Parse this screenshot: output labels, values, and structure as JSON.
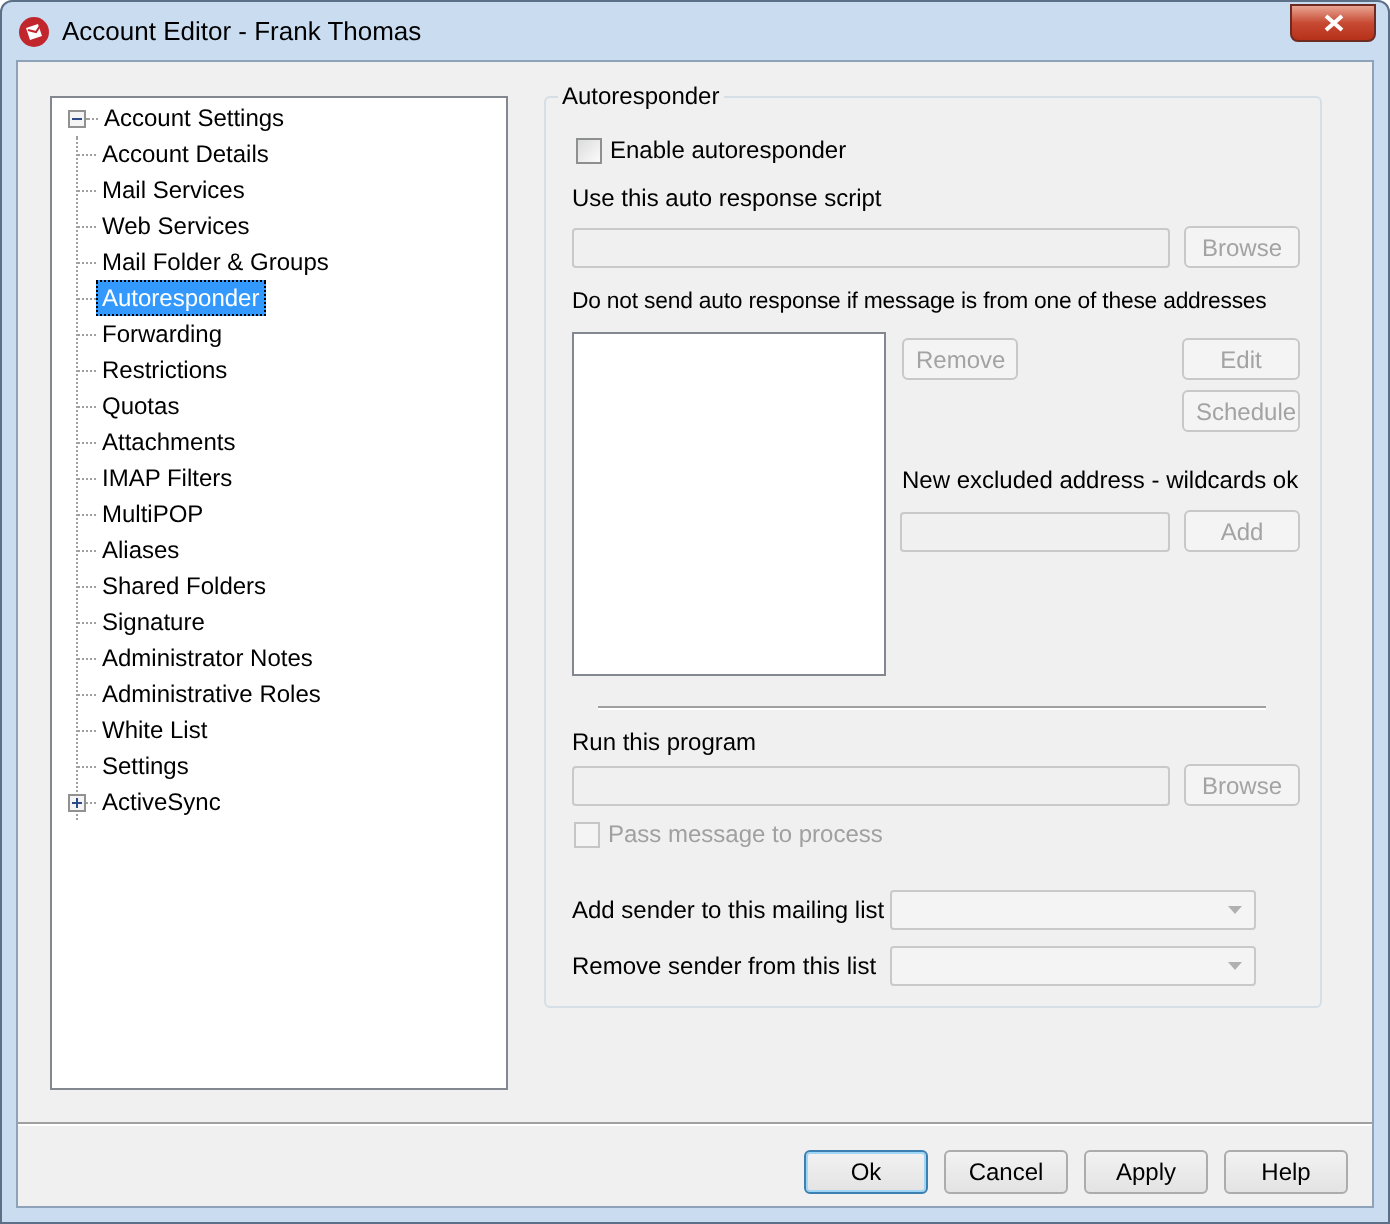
{
  "window": {
    "title": "Account Editor - Frank Thomas"
  },
  "tree": [
    {
      "label": "Account Settings",
      "selected": false,
      "expanded": true,
      "children": [
        {
          "label": "Account Details",
          "selected": false
        },
        {
          "label": "Mail Services",
          "selected": false
        },
        {
          "label": "Web Services",
          "selected": false
        },
        {
          "label": "Mail Folder & Groups",
          "selected": false
        },
        {
          "label": "Autoresponder",
          "selected": true
        },
        {
          "label": "Forwarding",
          "selected": false
        },
        {
          "label": "Restrictions",
          "selected": false
        },
        {
          "label": "Quotas",
          "selected": false
        },
        {
          "label": "Attachments",
          "selected": false
        },
        {
          "label": "IMAP Filters",
          "selected": false
        },
        {
          "label": "MultiPOP",
          "selected": false
        },
        {
          "label": "Aliases",
          "selected": false
        },
        {
          "label": "Shared Folders",
          "selected": false
        },
        {
          "label": "Signature",
          "selected": false
        },
        {
          "label": "Administrator Notes",
          "selected": false
        },
        {
          "label": "Administrative Roles",
          "selected": false
        },
        {
          "label": "White List",
          "selected": false
        },
        {
          "label": "Settings",
          "selected": false
        },
        {
          "label": "ActiveSync",
          "selected": false,
          "expanded": false
        }
      ]
    }
  ],
  "autoresponder": {
    "title": "Autoresponder",
    "enable": {
      "label": "Enable autoresponder",
      "checked": false,
      "disabled": false
    },
    "script_label": "Use this auto response script",
    "script_field": {
      "disabled": true
    },
    "script_browse": {
      "label": "Browse",
      "disabled": true
    },
    "exclude_label": "Do not send auto response if message is from one of these addresses",
    "remove_button": {
      "label": "Remove",
      "disabled": true
    },
    "edit_button": {
      "label": "Edit",
      "disabled": true
    },
    "schedule_button": {
      "label": "Schedule",
      "disabled": true
    },
    "new_address_label": "New excluded address - wildcards ok",
    "new_address_field": {
      "disabled": true
    },
    "add_button": {
      "label": "Add",
      "disabled": true
    },
    "program_label": "Run this program",
    "program_field": {
      "disabled": true
    },
    "program_browse": {
      "label": "Browse",
      "disabled": true
    },
    "pass_message": {
      "label": "Pass message to process",
      "checked": false,
      "disabled": true
    },
    "mailing_lists": [
      {
        "label": "Add sender to this mailing list",
        "disabled": true
      },
      {
        "label": "Remove sender from this list",
        "disabled": true
      }
    ]
  },
  "buttons": [
    {
      "label": "Ok",
      "default": true
    },
    {
      "label": "Cancel",
      "default": false
    },
    {
      "label": "Apply",
      "default": false
    },
    {
      "label": "Help",
      "default": false
    }
  ]
}
